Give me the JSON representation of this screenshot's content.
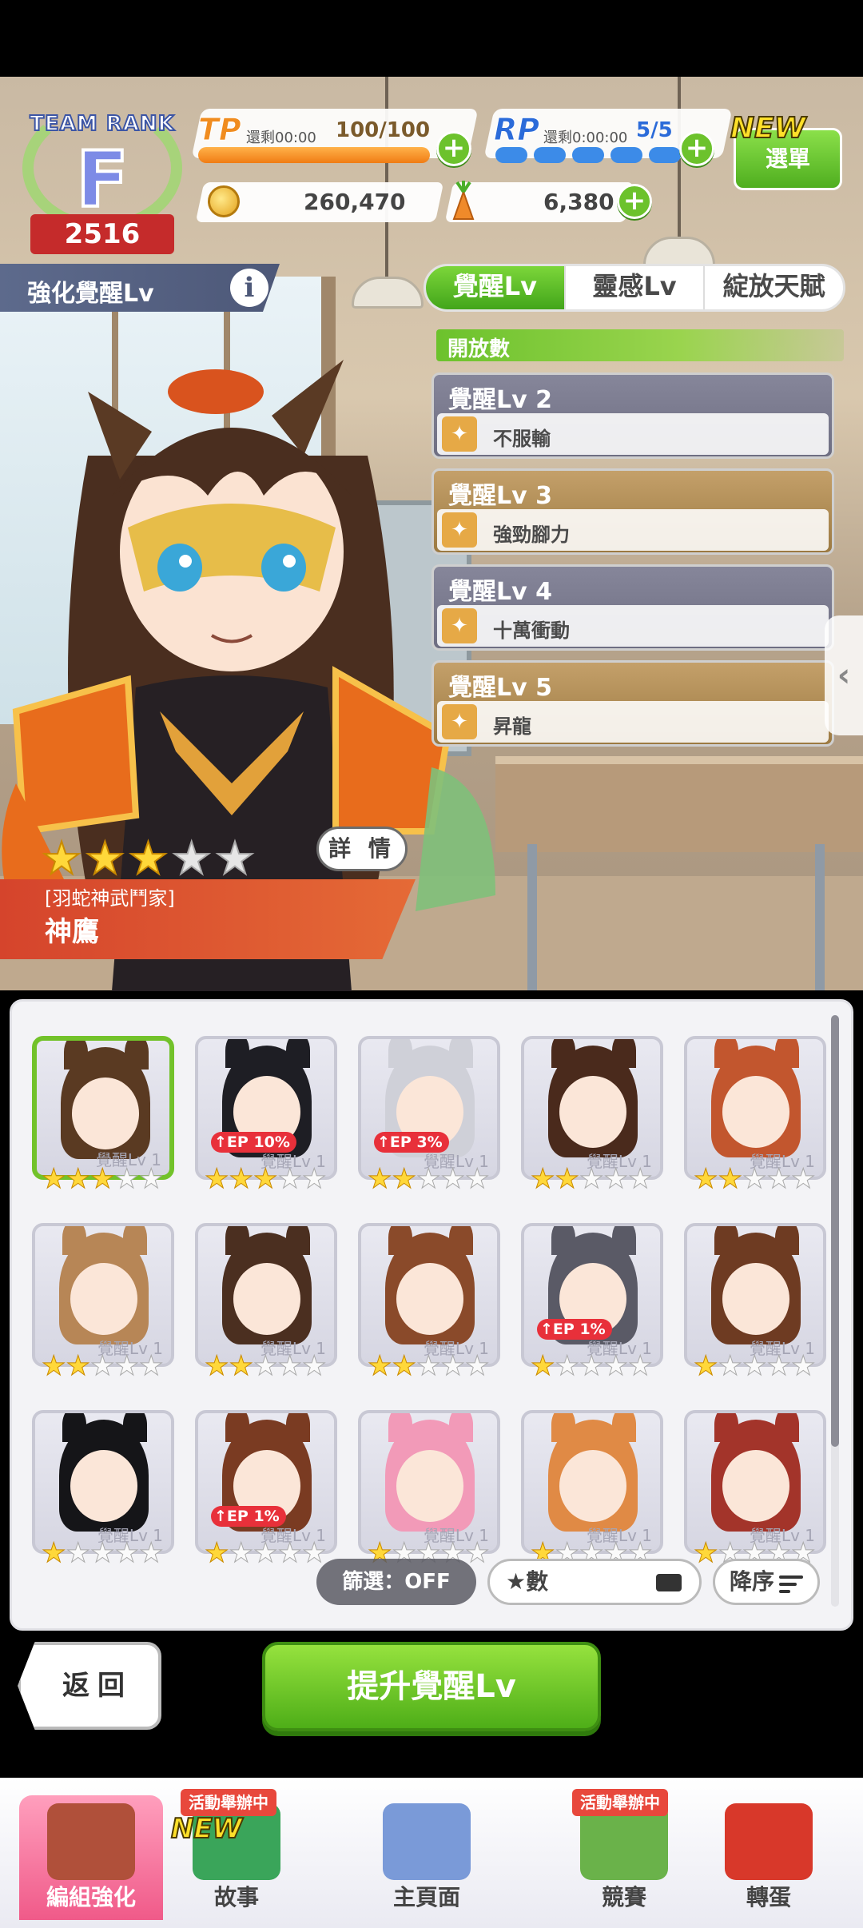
{
  "header": {
    "team_rank_title": "TEAM RANK",
    "team_rank_letter": "F",
    "team_rank_score": "2516",
    "tp": {
      "label": "TP",
      "remaining": "還剩00:00",
      "count": "100/100",
      "fill": 1.0
    },
    "rp": {
      "label": "RP",
      "remaining": "還剩0:00:00",
      "count": "5/5",
      "filled_dots": 5
    },
    "menu_new_tag": "NEW",
    "menu_label": "選單",
    "money": "260,470",
    "carats": "6,380"
  },
  "section": {
    "title": "強化覺醒Lv",
    "info_label": "i"
  },
  "tabs": [
    {
      "label": "覺醒Lv",
      "active": true
    },
    {
      "label": "靈感Lv",
      "active": false
    },
    {
      "label": "綻放天賦",
      "active": false
    }
  ],
  "unlock_header": "開放數",
  "awakenings": [
    {
      "level": "覺醒Lv 2",
      "skill": "不服輸",
      "style": "gray"
    },
    {
      "level": "覺醒Lv 3",
      "skill": "強勁腳力",
      "style": "gold"
    },
    {
      "level": "覺醒Lv 4",
      "skill": "十萬衝動",
      "style": "gray"
    },
    {
      "level": "覺醒Lv 5",
      "skill": "昇龍",
      "style": "gold"
    }
  ],
  "character": {
    "stars": 3,
    "max_stars": 5,
    "detail_label": "詳 情",
    "title": "[羽蛇神武鬥家]",
    "name": "神鷹"
  },
  "cards": [
    {
      "stars": 3,
      "lv": "覺醒Lv 1",
      "ep": "",
      "hair": "#5a3a22",
      "selected": true
    },
    {
      "stars": 3,
      "lv": "覺醒Lv 1",
      "ep": "EP 10%",
      "hair": "#1e1e24"
    },
    {
      "stars": 2,
      "lv": "覺醒Lv 1",
      "ep": "EP 3%",
      "hair": "#cfd0d8"
    },
    {
      "stars": 2,
      "lv": "覺醒Lv 1",
      "ep": "",
      "hair": "#4a2a1c"
    },
    {
      "stars": 2,
      "lv": "覺醒Lv 1",
      "ep": "",
      "hair": "#c2562e"
    },
    {
      "stars": 2,
      "lv": "覺醒Lv 1",
      "ep": "",
      "hair": "#b78656"
    },
    {
      "stars": 2,
      "lv": "覺醒Lv 1",
      "ep": "",
      "hair": "#4b2f20"
    },
    {
      "stars": 2,
      "lv": "覺醒Lv 1",
      "ep": "",
      "hair": "#8a4a2a"
    },
    {
      "stars": 1,
      "lv": "覺醒Lv 1",
      "ep": "EP 1%",
      "hair": "#5a5a66"
    },
    {
      "stars": 1,
      "lv": "覺醒Lv 1",
      "ep": "",
      "hair": "#6e3b22"
    },
    {
      "stars": 1,
      "lv": "覺醒Lv 1",
      "ep": "",
      "hair": "#151518"
    },
    {
      "stars": 1,
      "lv": "覺醒Lv 1",
      "ep": "EP 1%",
      "hair": "#7a3b22"
    },
    {
      "stars": 1,
      "lv": "覺醒Lv 1",
      "ep": "",
      "hair": "#f29ab8"
    },
    {
      "stars": 1,
      "lv": "覺醒Lv 1",
      "ep": "",
      "hair": "#e08a45"
    },
    {
      "stars": 1,
      "lv": "覺醒Lv 1",
      "ep": "",
      "hair": "#a3342a"
    }
  ],
  "filter": {
    "label": "篩選：OFF"
  },
  "sort": {
    "label": "★數"
  },
  "order": {
    "label": "降序"
  },
  "actions": {
    "back": "返回",
    "upgrade": "提升覺醒Lv"
  },
  "nav": [
    {
      "label": "編組強化",
      "active": true,
      "color": "#b0503a"
    },
    {
      "label": "故事",
      "active": false,
      "color": "#3aa55a",
      "new": "NEW"
    },
    {
      "label": "主頁面",
      "active": false,
      "color": "#7a9ad8"
    },
    {
      "label": "競賽",
      "active": false,
      "color": "#6ab24a",
      "event": "活動舉辦中"
    },
    {
      "label": "轉蛋",
      "active": false,
      "color": "#d8382a"
    }
  ],
  "nav_event_tag": "活動舉辦中"
}
